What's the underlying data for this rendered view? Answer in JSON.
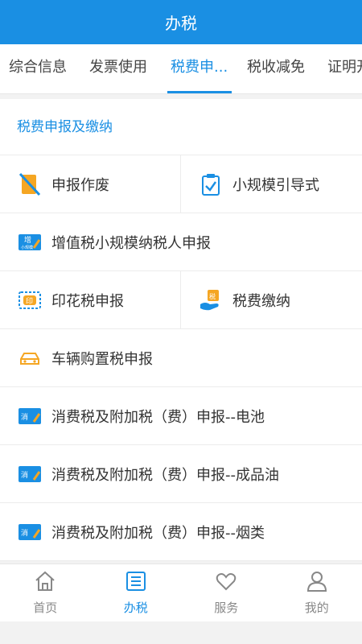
{
  "header": {
    "title": "办税"
  },
  "tabs": [
    {
      "label": "综合信息"
    },
    {
      "label": "发票使用"
    },
    {
      "label": "税费申..."
    },
    {
      "label": "税收减免"
    },
    {
      "label": "证明开"
    }
  ],
  "section": {
    "title": "税费申报及缴纳"
  },
  "items": [
    {
      "label": "申报作废",
      "icon": "void-declaration-icon"
    },
    {
      "label": "小规模引导式",
      "icon": "clipboard-check-icon"
    },
    {
      "label": "增值税小规模纳税人申报",
      "icon": "vat-icon",
      "icon_text": "增",
      "icon_subtext": "小规模"
    },
    {
      "label": "印花税申报",
      "icon": "stamp-icon",
      "icon_text": "印"
    },
    {
      "label": "税费缴纳",
      "icon": "tax-payment-hand-icon",
      "icon_text": "税"
    },
    {
      "label": "车辆购置税申报",
      "icon": "car-icon"
    },
    {
      "label": "消费税及附加税（费）申报--电池",
      "icon": "consumption-tax-icon",
      "icon_text": "消"
    },
    {
      "label": "消费税及附加税（费）申报--成品油",
      "icon": "consumption-tax-icon",
      "icon_text": "消"
    },
    {
      "label": "消费税及附加税（费）申报--烟类",
      "icon": "consumption-tax-icon",
      "icon_text": "消"
    }
  ],
  "bottom_nav": [
    {
      "label": "首页",
      "icon": "home-icon"
    },
    {
      "label": "办税",
      "icon": "list-icon"
    },
    {
      "label": "服务",
      "icon": "heart-icon"
    },
    {
      "label": "我的",
      "icon": "user-icon"
    }
  ],
  "colors": {
    "primary": "#1a8fe3",
    "orange": "#f5a623"
  }
}
